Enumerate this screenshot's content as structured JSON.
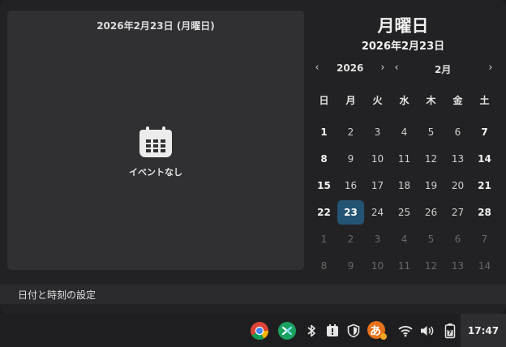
{
  "events": {
    "header_date": "2026年2月23日 (月曜日)",
    "empty_label": "イベントなし"
  },
  "calendar": {
    "weekday": "月曜日",
    "date": "2026年2月23日",
    "year": "2026",
    "month": "2月",
    "prev_arrow": "‹",
    "next_arrow": "›",
    "weekday_headers": [
      "日",
      "月",
      "火",
      "水",
      "木",
      "金",
      "土"
    ],
    "today": "23",
    "weeks": [
      [
        "1",
        "2",
        "3",
        "4",
        "5",
        "6",
        "7"
      ],
      [
        "8",
        "9",
        "10",
        "11",
        "12",
        "13",
        "14"
      ],
      [
        "15",
        "16",
        "17",
        "18",
        "19",
        "20",
        "21"
      ],
      [
        "22",
        "23",
        "24",
        "25",
        "26",
        "27",
        "28"
      ],
      [
        "1",
        "2",
        "3",
        "4",
        "5",
        "6",
        "7"
      ],
      [
        "8",
        "9",
        "10",
        "11",
        "12",
        "13",
        "14"
      ]
    ]
  },
  "settings": {
    "label": "日付と時刻の設定"
  },
  "taskbar": {
    "apps": [
      "chrome-icon",
      "remote-desktop-icon"
    ],
    "tray": [
      "bluetooth-icon",
      "notification-icon",
      "shield-icon",
      "ime-icon",
      "wifi-icon",
      "volume-icon",
      "battery-icon"
    ],
    "ime_glyph": "あ",
    "clock": "17:47"
  },
  "colors": {
    "today_highlight": "#245474",
    "panel": "#222224",
    "events_panel": "#303033"
  }
}
